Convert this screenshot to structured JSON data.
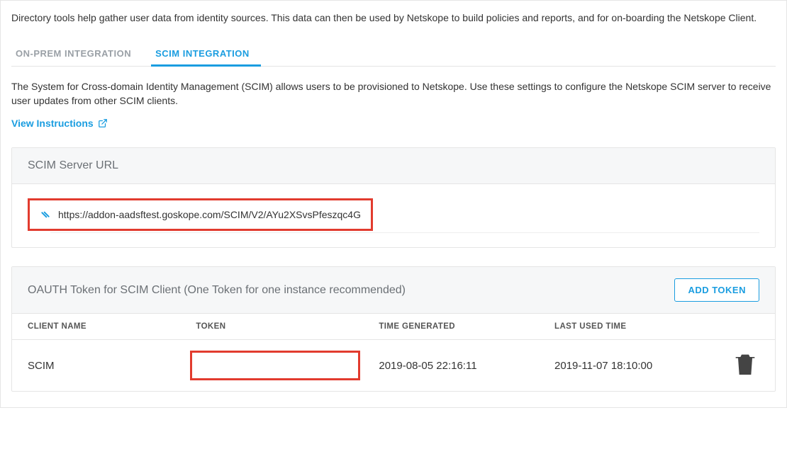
{
  "intro": "Directory tools help gather user data from identity sources. This data can then be used by Netskope to build policies and reports, and for on-boarding the Netskope Client.",
  "tabs": {
    "onprem": "ON-PREM INTEGRATION",
    "scim": "SCIM INTEGRATION"
  },
  "desc": "The System for Cross-domain Identity Management (SCIM) allows users to be provisioned to Netskope. Use these settings to configure the Netskope SCIM server to receive user updates from other SCIM clients.",
  "view_instructions": "View Instructions",
  "scim_server": {
    "title": "SCIM Server URL",
    "url": "https://addon-aadsftest.goskope.com/SCIM/V2/AYu2XSvsPfeszqc4G"
  },
  "oauth": {
    "title": "OAUTH Token for SCIM Client (One Token for one instance recommended)",
    "add_button": "ADD TOKEN",
    "columns": {
      "client": "CLIENT NAME",
      "token": "TOKEN",
      "time_generated": "TIME GENERATED",
      "last_used": "LAST USED TIME"
    },
    "rows": [
      {
        "client": "SCIM",
        "token": "",
        "time_generated": "2019-08-05 22:16:11",
        "last_used": "2019-11-07 18:10:00"
      }
    ]
  }
}
